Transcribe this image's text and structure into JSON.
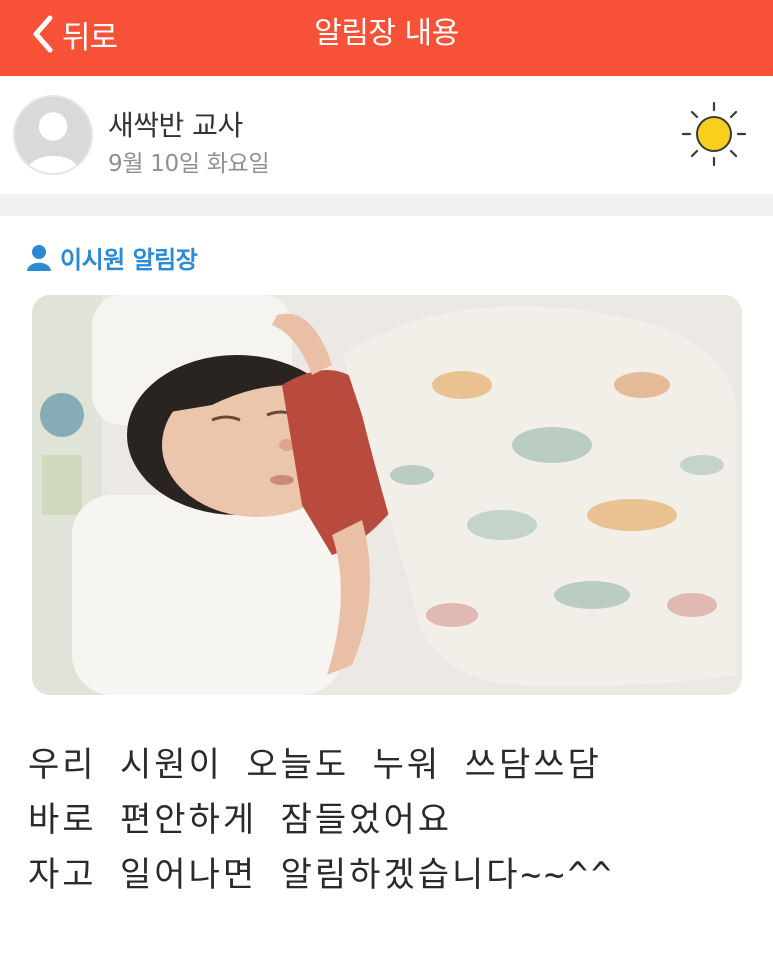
{
  "header": {
    "back_label": "뒤로",
    "title": "알림장 내용",
    "bar_color": "#f75237"
  },
  "author": {
    "name": "새싹반 교사",
    "date": "9월 10일 화요일",
    "weather_icon": "sun-icon"
  },
  "notice": {
    "target_label": "이시원 알림장",
    "target_icon": "person-icon",
    "target_color": "#2a8ad6",
    "photo": "sleeping-baby-photo",
    "message_lines": [
      "우리 시원이 오늘도 누워 쓰담쓰담",
      "바로 편안하게 잠들었어요",
      "자고 일어나면 알림하겠습니다~~^^"
    ]
  }
}
